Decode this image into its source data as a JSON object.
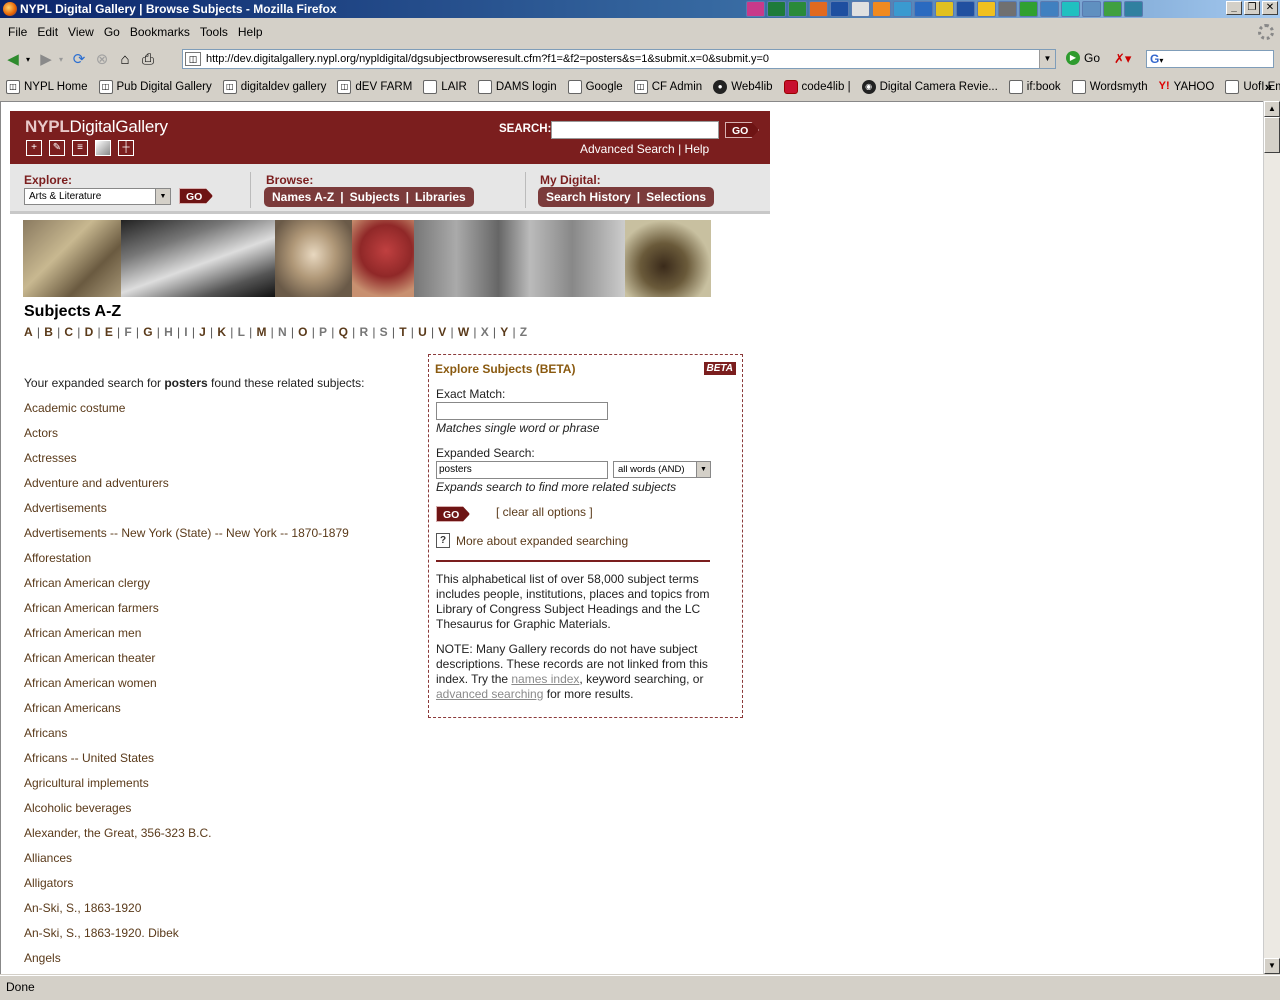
{
  "window": {
    "title": "NYPL Digital Gallery | Browse Subjects - Mozilla Firefox"
  },
  "menu": [
    "File",
    "Edit",
    "View",
    "Go",
    "Bookmarks",
    "Tools",
    "Help"
  ],
  "nav": {
    "url": "http://dev.digitalgallery.nypl.org/nypldigital/dgsubjectbrowseresult.cfm?f1=&f2=posters&s=1&submit.x=0&submit.y=0",
    "go_label": "Go",
    "search_engine": "G"
  },
  "bookmarks": [
    {
      "label": "NYPL Home",
      "icon": "nypl-icon"
    },
    {
      "label": "Pub Digital Gallery",
      "icon": "nypl-icon"
    },
    {
      "label": "digitaldev gallery",
      "icon": "nypl-icon"
    },
    {
      "label": "dEV FARM",
      "icon": "nypl-icon"
    },
    {
      "label": "LAIR",
      "icon": "page-icon"
    },
    {
      "label": "DAMS login",
      "icon": "page-icon"
    },
    {
      "label": "Google",
      "icon": "page-icon"
    },
    {
      "label": "CF Admin",
      "icon": "nypl-icon"
    },
    {
      "label": "Web4lib",
      "icon": "github-like-icon"
    },
    {
      "label": "code4lib |",
      "icon": "red-icon"
    },
    {
      "label": "Digital Camera Revie...",
      "icon": "dpreview-icon"
    },
    {
      "label": "if:book",
      "icon": "page-icon"
    },
    {
      "label": "Wordsmyth",
      "icon": "page-icon"
    },
    {
      "label": "YAHOO",
      "icon": "yahoo-icon"
    },
    {
      "label": "UofI Email",
      "icon": "page-icon"
    }
  ],
  "header": {
    "logo_nypl": "NYPL",
    "logo_rest": "DigitalGallery",
    "search_label": "SEARCH:",
    "go": "GO",
    "advanced": "Advanced Search",
    "sep": "|",
    "help": "Help"
  },
  "strip": {
    "explore_label": "Explore:",
    "explore_value": "Arts & Literature",
    "go": "GO",
    "browse_label": "Browse:",
    "browse": [
      "Names A-Z",
      "Subjects",
      "Libraries"
    ],
    "mydigital_label": "My Digital:",
    "mydigital": [
      "Search History",
      "Selections"
    ]
  },
  "subjects": {
    "heading": "Subjects A-Z",
    "letters": [
      "A",
      "B",
      "C",
      "D",
      "E",
      "F",
      "G",
      "H",
      "I",
      "J",
      "K",
      "L",
      "M",
      "N",
      "O",
      "P",
      "Q",
      "R",
      "S",
      "T",
      "U",
      "V",
      "W",
      "X",
      "Y",
      "Z"
    ],
    "intro_before": "Your expanded search for ",
    "intro_term": "posters",
    "intro_after": " found these related subjects:",
    "items": [
      "Academic costume",
      "Actors",
      "Actresses",
      "Adventure and adventurers",
      "Advertisements",
      "Advertisements -- New York (State) -- New York -- 1870-1879",
      "Afforestation",
      "African American clergy",
      "African American farmers",
      "African American men",
      "African American theater",
      "African American women",
      "African Americans",
      "Africans",
      "Africans -- United States",
      "Agricultural implements",
      "Alcoholic beverages",
      "Alexander, the Great, 356-323 B.C.",
      "Alliances",
      "Alligators",
      "An-Ski, S., 1863-1920",
      "An-Ski, S., 1863-1920. Dibek",
      "Angels"
    ]
  },
  "explore": {
    "title": "Explore Subjects (BETA)",
    "beta": "BETA",
    "exact_label": "Exact Match:",
    "exact_value": "",
    "exact_hint": "Matches single word or phrase",
    "expanded_label": "Expanded Search:",
    "expanded_value": "posters",
    "mode": "all words (AND)",
    "expanded_hint": "Expands search to find more related subjects",
    "go": "GO",
    "clear": "[ clear all options ]",
    "more": "More about expanded searching",
    "para1": "This alphabetical list of over 58,000 subject terms includes people, institutions, places and topics from Library of Congress Subject Headings and the LC Thesaurus for Graphic Materials.",
    "note_a": "NOTE: Many Gallery records do not have subject descriptions. These records are not linked from this index. Try the ",
    "note_link1": "names index",
    "note_b": ", keyword searching, or ",
    "note_link2": "advanced searching",
    "note_c": " for more results."
  },
  "status": "Done"
}
